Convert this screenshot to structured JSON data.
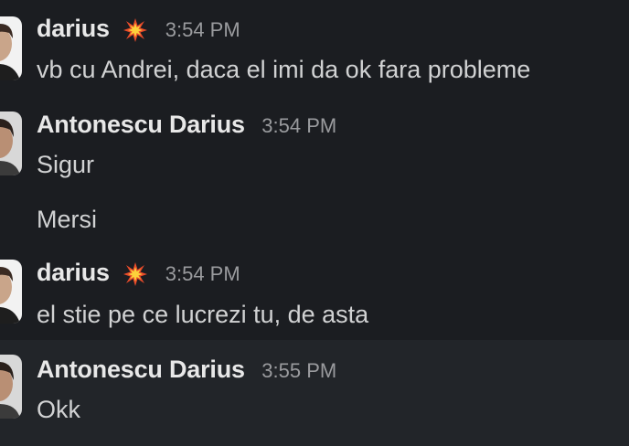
{
  "messages": [
    {
      "author": "darius",
      "badge_icon": "collision-emoji",
      "time": "3:54 PM",
      "lines": [
        "vb cu Andrei, daca el imi da ok fara probleme"
      ]
    },
    {
      "author": "Antonescu Darius",
      "time": "3:54 PM",
      "lines": [
        "Sigur",
        "Mersi"
      ]
    },
    {
      "author": "darius",
      "badge_icon": "collision-emoji",
      "time": "3:54 PM",
      "lines": [
        "el stie pe ce lucrezi tu, de asta"
      ]
    },
    {
      "author": "Antonescu Darius",
      "time": "3:55 PM",
      "lines": [
        "Okk"
      ]
    }
  ],
  "colors": {
    "background": "#1b1d21",
    "hover_background": "#222529",
    "author": "#e8e8e8",
    "text": "#d1d2d3",
    "timestamp": "#9a9b9e"
  }
}
